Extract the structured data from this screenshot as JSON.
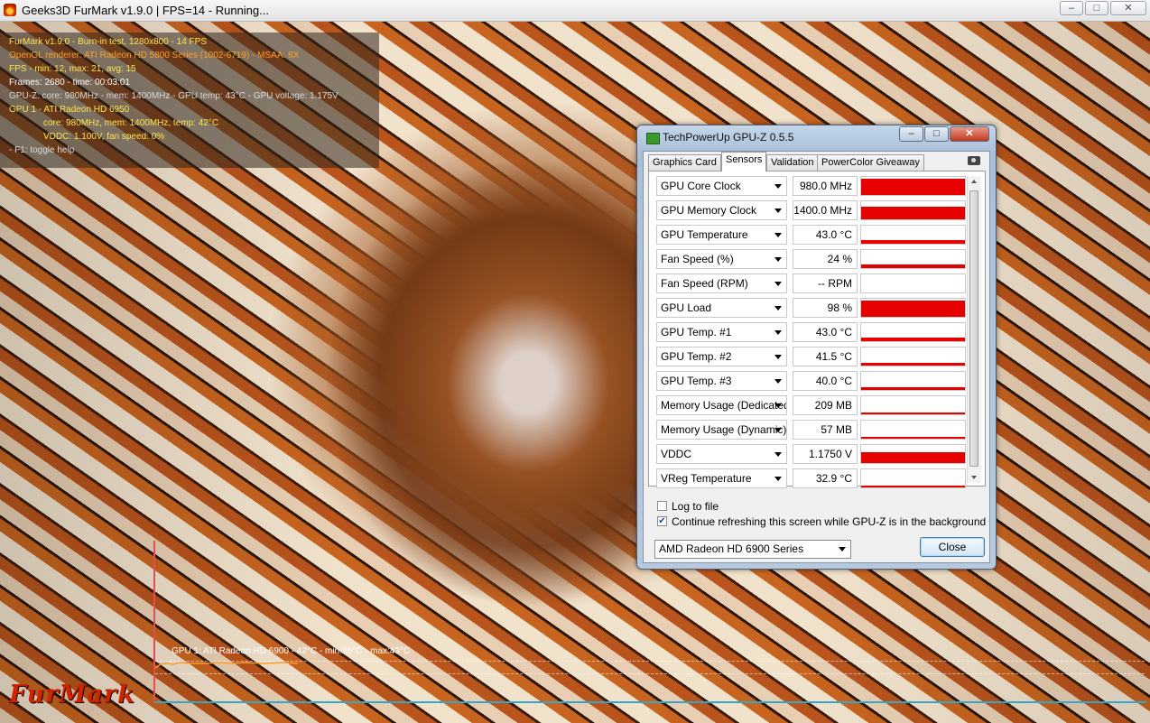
{
  "furmark": {
    "window_title": "Geeks3D FurMark v1.9.0 | FPS=14 - Running...",
    "overlay": [
      "FurMark v1.9.0 - Burn-in test, 1280x800 - 14 FPS",
      "OpenGL renderer: ATI Radeon HD 5800 Series (1002-6719) - MSAA: 8X",
      "FPS - min: 12, max: 21, avg: 15",
      "Frames: 2680 - time: 00:03:01",
      "GPU-Z: core: 980MHz - mem: 1400MHz - GPU temp: 43°C - GPU voltage: 1.175V",
      "GPU 1 - ATI Radeon HD 6950",
      "core: 980MHz, mem: 1400MHz, temp: 42°C",
      "VDDC: 1.100V, fan speed: 0%",
      "- F1: toggle help"
    ],
    "graph_label": "GPU 1: ATI Radeon HD 6900 - 42°C - min:35°C - max:43°C",
    "logo": "FurMark",
    "colors": {
      "overlay_yellow": "#ffe34d",
      "overlay_orange": "#ff9d2a",
      "graph_axis_red": "#e05050",
      "graph_axis_blue": "#33a6c9"
    }
  },
  "gpuz": {
    "title": "TechPowerUp GPU-Z 0.5.5",
    "tabs": [
      "Graphics Card",
      "Sensors",
      "Validation",
      "PowerColor Giveaway"
    ],
    "active_tab": "Sensors",
    "sensors": [
      {
        "name": "GPU Core Clock",
        "value": "980.0 MHz",
        "level": 1.0
      },
      {
        "name": "GPU Memory Clock",
        "value": "1400.0 MHz",
        "level": 0.75
      },
      {
        "name": "GPU Temperature",
        "value": "43.0 °C",
        "level": 0.2
      },
      {
        "name": "Fan Speed (%)",
        "value": "24 %",
        "level": 0.2
      },
      {
        "name": "Fan Speed (RPM)",
        "value": "-- RPM",
        "level": 0.0
      },
      {
        "name": "GPU Load",
        "value": "98 %",
        "level": 0.98
      },
      {
        "name": "GPU Temp. #1",
        "value": "43.0 °C",
        "level": 0.2
      },
      {
        "name": "GPU Temp. #2",
        "value": "41.5 °C",
        "level": 0.18
      },
      {
        "name": "GPU Temp. #3",
        "value": "40.0 °C",
        "level": 0.15
      },
      {
        "name": "Memory Usage (Dedicated)",
        "value": "209 MB",
        "level": 0.1
      },
      {
        "name": "Memory Usage (Dynamic)",
        "value": "57 MB",
        "level": 0.06
      },
      {
        "name": "VDDC",
        "value": "1.1750 V",
        "level": 0.65
      },
      {
        "name": "VReg Temperature",
        "value": "32.9 °C",
        "level": 0.12
      }
    ],
    "log_to_file": {
      "label": "Log to file",
      "checked": false
    },
    "continue_refresh": {
      "label": "Continue refreshing this screen while GPU-Z is in the background",
      "checked": true
    },
    "device_select": "AMD Radeon HD 6900 Series",
    "close_label": "Close",
    "colors": {
      "sensor_bar": "#e60000"
    }
  }
}
